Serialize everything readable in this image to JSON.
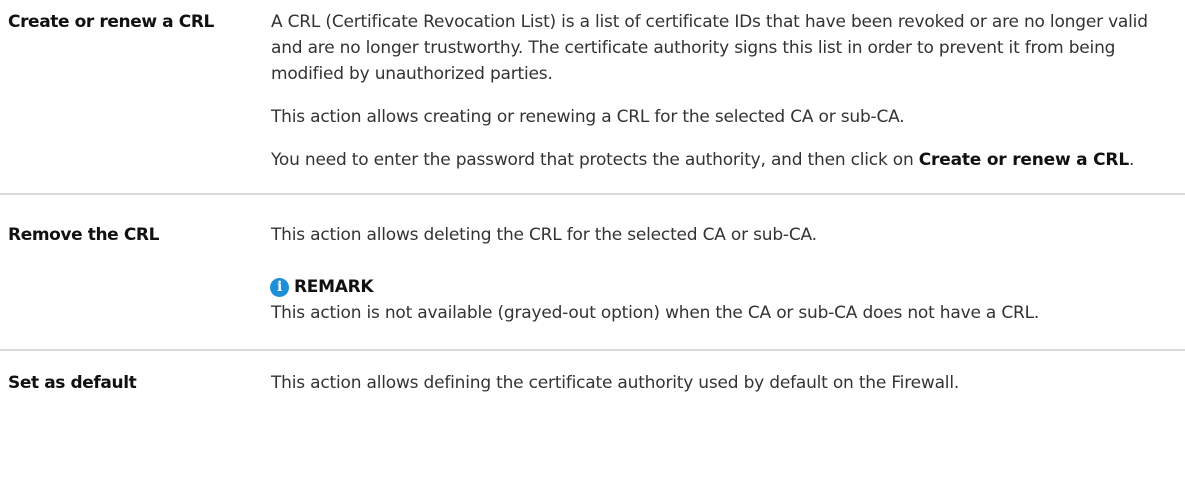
{
  "rows": [
    {
      "term": "Create or renew a CRL",
      "paragraphs": [
        "A CRL (Certificate Revocation List) is a list of certificate IDs that have been revoked or are no longer valid and are no longer trustworthy. The certificate authority signs this list in order to prevent it from being modified by unauthorized parties.",
        "This action allows creating or renewing a CRL for the selected CA or sub-CA."
      ],
      "final_paragraph": {
        "text": "You need to enter the password that protects the authority, and then click on ",
        "bold": "Create or renew a CRL",
        "suffix": "."
      }
    },
    {
      "term": "Remove the CRL",
      "paragraphs": [
        "This action allows deleting the CRL for the selected CA or sub-CA."
      ],
      "remark": {
        "icon": "info-icon",
        "title": "REMARK",
        "text": "This action is not available (grayed-out option) when the CA or sub-CA does not have a CRL."
      }
    },
    {
      "term": "Set as default",
      "paragraphs": [
        "This action allows defining the certificate authority used by default on the Firewall."
      ]
    }
  ],
  "colors": {
    "text": "#333333",
    "term": "#111111",
    "divider": "#d9d9d9",
    "info_icon": "#1e8fd6"
  }
}
